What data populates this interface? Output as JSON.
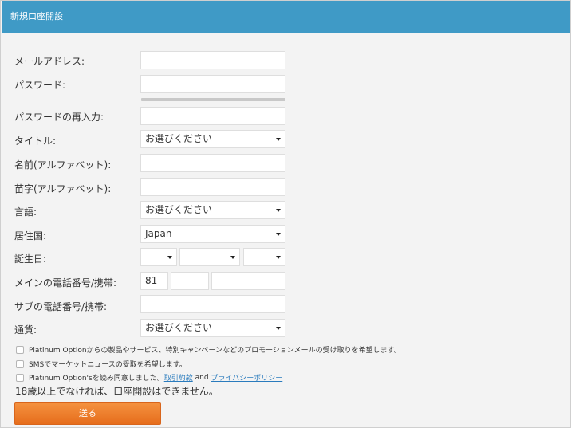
{
  "header": {
    "title": "新規口座開設"
  },
  "form": {
    "email": {
      "label": "メールアドレス:",
      "value": ""
    },
    "password": {
      "label": "パスワード:",
      "value": ""
    },
    "password_confirm": {
      "label": "パスワードの再入力:",
      "value": ""
    },
    "title": {
      "label": "タイトル:",
      "selected": "お選びください"
    },
    "first_name": {
      "label": "名前(アルファベット):",
      "value": ""
    },
    "last_name": {
      "label": "苗字(アルファベット):",
      "value": ""
    },
    "language": {
      "label": "言語:",
      "selected": "お選びください"
    },
    "country": {
      "label": "居住国:",
      "selected": "Japan"
    },
    "birthday": {
      "label": "誕生日:",
      "day": "--",
      "month": "--",
      "year": "--"
    },
    "main_phone": {
      "label": "メインの電話番号/携帯:",
      "country_code": "81",
      "area_code": "",
      "number": ""
    },
    "sub_phone": {
      "label": "サブの電話番号/携帯:",
      "value": ""
    },
    "currency": {
      "label": "通貨:",
      "selected": "お選びください"
    },
    "checkboxes": {
      "promo": "Platinum Optionからの製品やサービス、特別キャンペーンなどのプロモーションメールの受け取りを希望します。",
      "sms": "SMSでマーケットニュースの受取を希望します。",
      "terms_prefix": "Platinum Option'sを読み同意しました。",
      "terms_link": "取引約款",
      "terms_and": "and",
      "privacy_link": "プライバシーポリシー"
    },
    "age_note": "18歳以上でなければ、口座開設はできません。",
    "submit_label": "送る"
  }
}
